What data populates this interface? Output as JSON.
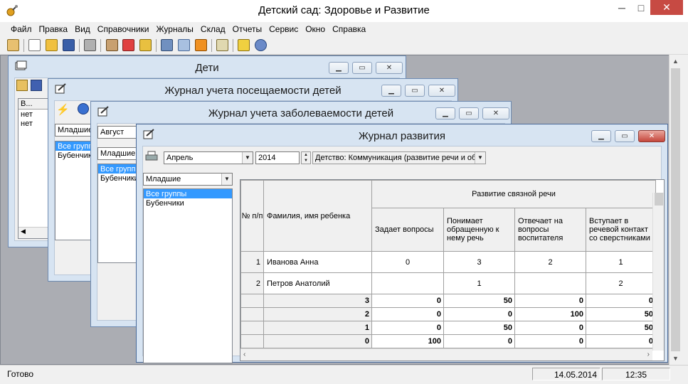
{
  "app": {
    "title": "Детский сад: Здоровье и Развитие",
    "minimize": "─",
    "maximize": "□",
    "close": "✕"
  },
  "menu": [
    "Файл",
    "Правка",
    "Вид",
    "Справочники",
    "Журналы",
    "Склад",
    "Отчеты",
    "Сервис",
    "Окно",
    "Справка"
  ],
  "toolbar_icons": [
    "home-icon",
    "new-document-icon",
    "open-folder-icon",
    "save-icon",
    "print-icon",
    "contacts-icon",
    "medicine-icon",
    "lock-icon",
    "users-icon",
    "table-icon",
    "diamond-icon",
    "edit-icon",
    "battery-icon",
    "globe-icon"
  ],
  "windows": {
    "children": {
      "title": "Дети",
      "col_header": "В...",
      "rows": [
        "нет",
        "нет"
      ]
    },
    "attendance": {
      "title": "Журнал учета посещаемости детей",
      "group_combo": "Младшие",
      "groups": [
        "Все группы",
        "Бубенчики"
      ]
    },
    "illness": {
      "title": "Журнал учета заболеваемости детей",
      "month_combo": "Август",
      "group_combo": "Младшие",
      "groups": [
        "Все группы",
        "Бубенчики"
      ]
    },
    "development": {
      "title": "Журнал развития",
      "month": "Апрель",
      "year": "2014",
      "area": "Детство: Коммуникация (развитие речи и об",
      "group_combo": "Младшие",
      "groups": [
        "Все группы",
        "Бубенчики"
      ],
      "grid": {
        "col_num": "№ п/п",
        "col_name": "Фамилия, имя ребенка",
        "group_header": "Развитие связной речи",
        "columns": [
          "Задает вопросы",
          "Понимает обращенную к нему речь",
          "Отвечает на вопросы воспитателя",
          "Вступает в речевой контакт со сверстниками"
        ],
        "rows": [
          {
            "num": "1",
            "name": "Иванова Анна",
            "values": [
              "0",
              "3",
              "2",
              "1"
            ]
          },
          {
            "num": "2",
            "name": "Петров Анатолий",
            "values": [
              "",
              "1",
              "",
              "2"
            ]
          }
        ],
        "summary": [
          {
            "level": "3",
            "values": [
              "0",
              "50",
              "0",
              "0"
            ]
          },
          {
            "level": "2",
            "values": [
              "0",
              "0",
              "100",
              "50"
            ]
          },
          {
            "level": "1",
            "values": [
              "0",
              "50",
              "0",
              "50"
            ]
          },
          {
            "level": "0",
            "values": [
              "100",
              "0",
              "0",
              "0"
            ]
          }
        ]
      }
    }
  },
  "status": {
    "text": "Готово",
    "date": "14.05.2014",
    "time": "12:35"
  }
}
